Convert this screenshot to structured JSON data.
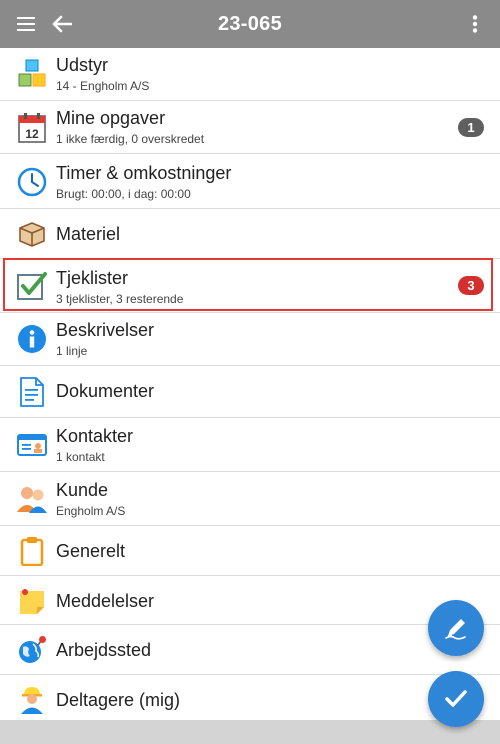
{
  "appbar": {
    "title": "23-065",
    "menu_icon": "menu-icon",
    "back_icon": "back-arrow-icon",
    "more_icon": "more-vert-icon"
  },
  "items": [
    {
      "label": "Udstyr",
      "sub": "14 - Engholm A/S",
      "icon": "cubes-icon"
    },
    {
      "label": "Mine opgaver",
      "sub": "1 ikke færdig, 0 overskredet",
      "icon": "calendar-icon",
      "badge": "1",
      "badge_color": "#5f5f5f"
    },
    {
      "label": "Timer & omkostninger",
      "sub": "Brugt: 00:00, i dag: 00:00",
      "icon": "clock-icon"
    },
    {
      "label": "Materiel",
      "sub": "",
      "icon": "box-icon"
    },
    {
      "label": "Tjeklister",
      "sub": "3 tjeklister, 3 resterende",
      "icon": "checkbox-icon",
      "badge": "3",
      "badge_color": "#d32f2f"
    },
    {
      "label": "Beskrivelser",
      "sub": "1 linje",
      "icon": "info-icon"
    },
    {
      "label": "Dokumenter",
      "sub": "",
      "icon": "document-icon"
    },
    {
      "label": "Kontakter",
      "sub": "1 kontakt",
      "icon": "contact-card-icon"
    },
    {
      "label": "Kunde",
      "sub": "Engholm A/S",
      "icon": "people-icon"
    },
    {
      "label": "Generelt",
      "sub": "",
      "icon": "clipboard-icon"
    },
    {
      "label": "Meddelelser",
      "sub": "",
      "icon": "sticky-note-icon"
    },
    {
      "label": "Arbejdssted",
      "sub": "",
      "icon": "globe-pin-icon"
    },
    {
      "label": "Deltagere (mig)",
      "sub": "",
      "icon": "worker-icon"
    }
  ],
  "fabs": {
    "edit_icon": "pen-icon",
    "done_icon": "check-icon"
  },
  "colors": {
    "appbar": "#8a8a8a",
    "accent": "#2f86d6",
    "badge_gray": "#5f5f5f",
    "badge_red": "#d32f2f",
    "highlight": "#e53935"
  }
}
